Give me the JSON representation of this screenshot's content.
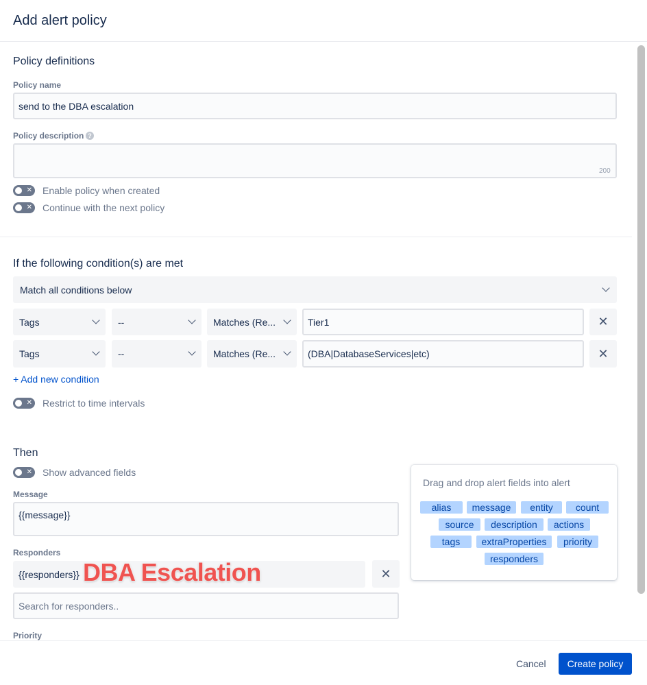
{
  "dialog": {
    "title": "Add alert policy"
  },
  "definitions": {
    "heading": "Policy definitions",
    "name_label": "Policy name",
    "name_value": "send to the DBA escalation",
    "description_label": "Policy description",
    "description_help_icon": "question-circle-icon",
    "description_counter": "200",
    "toggle_enable_label": "Enable policy when created",
    "toggle_continue_label": "Continue with the next policy"
  },
  "conditions": {
    "heading": "If the following condition(s) are met",
    "match_select": "Match all conditions below",
    "rows": [
      {
        "field": "Tags",
        "not": "--",
        "operation": "Matches (Re...",
        "value": "Tier1"
      },
      {
        "field": "Tags",
        "not": "--",
        "operation": "Matches (Re...",
        "value": "(DBA|DatabaseServices|etc)"
      }
    ],
    "add_condition_label": "+ Add new condition",
    "time_toggle_label": "Restrict to time intervals"
  },
  "then": {
    "heading": "Then",
    "advanced_toggle_label": "Show advanced fields",
    "message_label": "Message",
    "message_value": "{{message}}",
    "responders_label": "Responders",
    "responders_value": "{{responders}}",
    "responders_search_placeholder": "Search for responders..",
    "priority_label": "Priority"
  },
  "annotation": {
    "text": "DBA Escalation",
    "color": "#ef5350"
  },
  "alert_fields": {
    "title": "Drag and drop alert fields into alert",
    "chips": [
      "alias",
      "message",
      "entity",
      "count",
      "source",
      "description",
      "actions",
      "tags",
      "extraProperties",
      "priority",
      "responders"
    ]
  },
  "footer": {
    "cancel_label": "Cancel",
    "create_label": "Create policy"
  },
  "colors": {
    "primary": "#0052cc",
    "chip_bg": "#b3d4ff",
    "chip_text": "#0747a6"
  }
}
